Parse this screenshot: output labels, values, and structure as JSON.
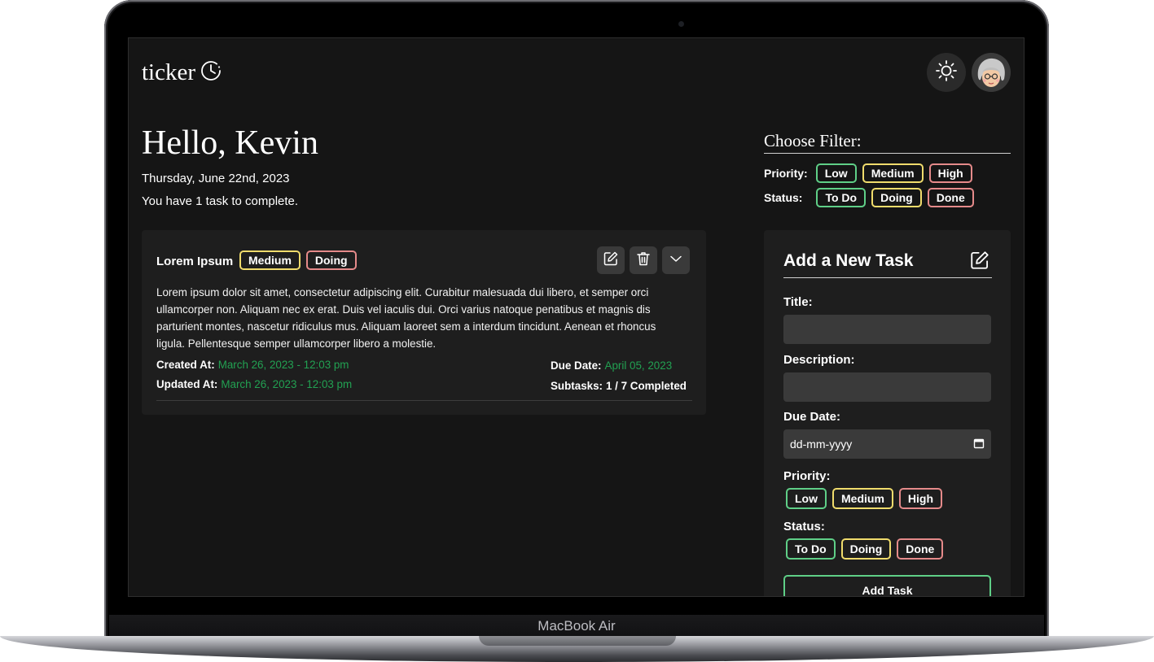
{
  "app": {
    "logo_text": "ticker",
    "logo_icon": "clock-icon",
    "theme_icon": "sun-icon",
    "avatar_icon": "avatar"
  },
  "greeting": "Hello, Kevin",
  "date": "Thursday, June 22nd, 2023",
  "task_count": "You have 1 task to complete.",
  "task": {
    "title": "Lorem Ipsum",
    "priority": "Medium",
    "status": "Doing",
    "description": "Lorem ipsum dolor sit amet, consectetur adipiscing elit. Curabitur malesuada dui libero, et semper orci ullamcorper non. Aliquam nec ex erat. Duis vel iaculis dui. Orci varius natoque penatibus et magnis dis parturient montes, nascetur ridiculus mus. Aliquam laoreet sem a interdum tincidunt. Aenean et rhoncus ligula. Pellentesque semper ullamcorper libero a molestie.",
    "created_label": "Created At:",
    "created_value": "March 26, 2023 - 12:03 pm",
    "updated_label": "Updated At:",
    "updated_value": "March 26, 2023 - 12:03 pm",
    "due_label": "Due Date:",
    "due_value": "April 05, 2023",
    "subtasks_label": "Subtasks:",
    "subtasks_value": "1 / 7 Completed",
    "actions": [
      "edit-icon",
      "trash-icon",
      "chevron-down-icon"
    ]
  },
  "filter": {
    "title": "Choose Filter:",
    "priority_label": "Priority:",
    "priority_options": [
      "Low",
      "Medium",
      "High"
    ],
    "status_label": "Status:",
    "status_options": [
      "To Do",
      "Doing",
      "Done"
    ]
  },
  "form": {
    "title": "Add a New Task",
    "title_label": "Title:",
    "title_value": "",
    "description_label": "Description:",
    "description_value": "",
    "due_label": "Due Date:",
    "due_placeholder": "dd-mm-yyyy",
    "priority_label": "Priority:",
    "priority_options": [
      "Low",
      "Medium",
      "High"
    ],
    "status_label": "Status:",
    "status_options": [
      "To Do",
      "Doing",
      "Done"
    ],
    "submit_label": "Add Task"
  },
  "device": {
    "label": "MacBook Air"
  },
  "colors": {
    "background": "#151515",
    "card": "#1e1e1e",
    "low": "#5fcf87",
    "medium": "#f0dc6c",
    "high": "#e58a8a",
    "date_green": "#22a152"
  }
}
